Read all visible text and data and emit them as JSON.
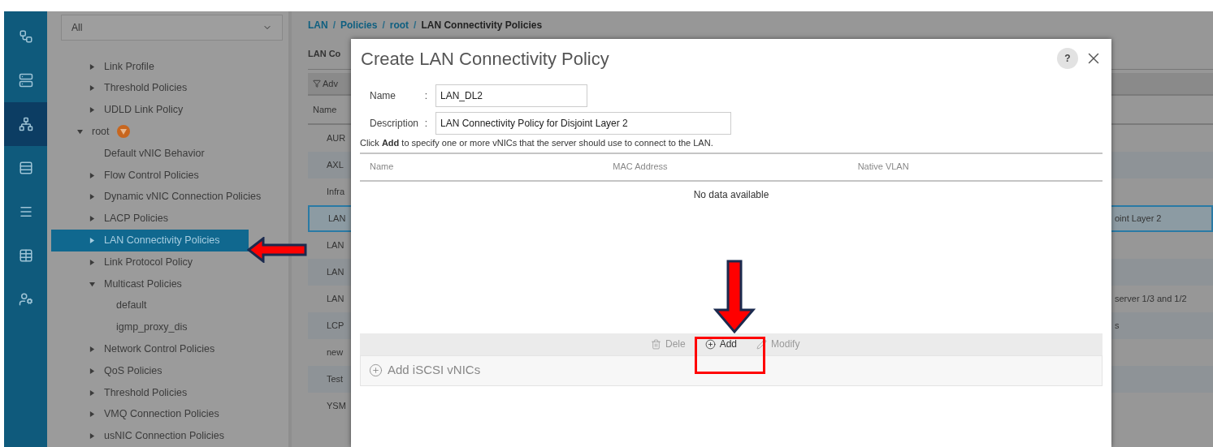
{
  "rail": [
    {
      "selected": false
    },
    {
      "selected": false
    },
    {
      "selected": true
    },
    {
      "selected": false
    },
    {
      "selected": false
    },
    {
      "selected": false
    },
    {
      "selected": false
    }
  ],
  "filter": {
    "value": "All"
  },
  "tree": [
    {
      "children": [
        {
          "label": "Link Profile",
          "expanded": false,
          "selected": false
        },
        {
          "label": "Threshold Policies",
          "expanded": false,
          "selected": false
        },
        {
          "label": "UDLD Link Policy",
          "expanded": false,
          "selected": false
        }
      ]
    },
    {
      "label": "root",
      "expanded": true,
      "selected": false,
      "badge": true,
      "children": [
        {
          "label": "Default vNIC Behavior",
          "selected": false
        },
        {
          "label": "Flow Control Policies",
          "expanded": false,
          "selected": false
        },
        {
          "label": "Dynamic vNIC Connection Policies",
          "expanded": false,
          "selected": false
        },
        {
          "label": "LACP Policies",
          "expanded": false,
          "selected": false
        },
        {
          "label": "LAN Connectivity Policies",
          "expanded": false,
          "selected": true
        },
        {
          "label": "Link Protocol Policy",
          "expanded": false,
          "selected": false
        },
        {
          "label": "Multicast Policies",
          "expanded": true,
          "selected": false,
          "children": [
            {
              "label": "default",
              "selected": false
            },
            {
              "label": "igmp_proxy_dis",
              "selected": false
            }
          ]
        },
        {
          "label": "Network Control Policies",
          "expanded": false,
          "selected": false
        },
        {
          "label": "QoS Policies",
          "expanded": false,
          "selected": false
        },
        {
          "label": "Threshold Policies",
          "expanded": false,
          "selected": false
        },
        {
          "label": "VMQ Connection Policies",
          "expanded": false,
          "selected": false
        },
        {
          "label": "usNIC Connection Policies",
          "expanded": false,
          "selected": false
        }
      ]
    }
  ],
  "breadcrumb": {
    "separator": "/",
    "links": [
      "LAN",
      "Policies",
      "root"
    ],
    "current": "LAN Connectivity Policies"
  },
  "list": {
    "title": "LAN Co",
    "filter_button": "Adv",
    "column": "Name",
    "rows": [
      {
        "name": "AUR",
        "selected": false
      },
      {
        "name": "AXL",
        "selected": false
      },
      {
        "name": "Infra",
        "selected": false
      },
      {
        "name": "LAN",
        "selected": true,
        "description": "oint Layer 2"
      },
      {
        "name": "LAN",
        "selected": false
      },
      {
        "name": "LAN",
        "selected": false
      },
      {
        "name": "LAN",
        "selected": false,
        "description": "server 1/3 and 1/2"
      },
      {
        "name": "LCP",
        "selected": false,
        "description": "s"
      },
      {
        "name": "new",
        "selected": false
      },
      {
        "name": "Test",
        "selected": false
      },
      {
        "name": "YSM",
        "selected": false
      }
    ]
  },
  "dialog": {
    "title": "Create LAN Connectivity Policy",
    "help": "?",
    "fields": [
      {
        "label": "Name",
        "colon": ":",
        "value": "LAN_DL2"
      },
      {
        "label": "Description",
        "colon": ":",
        "value": "LAN Connectivity Policy for Disjoint Layer 2"
      }
    ],
    "hint": "Click **Add** to specify one or more vNICs that the server should use to connect to the LAN.",
    "table": {
      "columns": [
        "Name",
        "MAC Address",
        "Native VLAN"
      ],
      "empty": "No data available"
    },
    "actions": [
      {
        "label": "Dele",
        "disabled": true
      },
      {
        "label": "Add",
        "disabled": false
      },
      {
        "label": "Modify",
        "disabled": true
      }
    ],
    "iscsi": "Add iSCSI vNICs"
  }
}
